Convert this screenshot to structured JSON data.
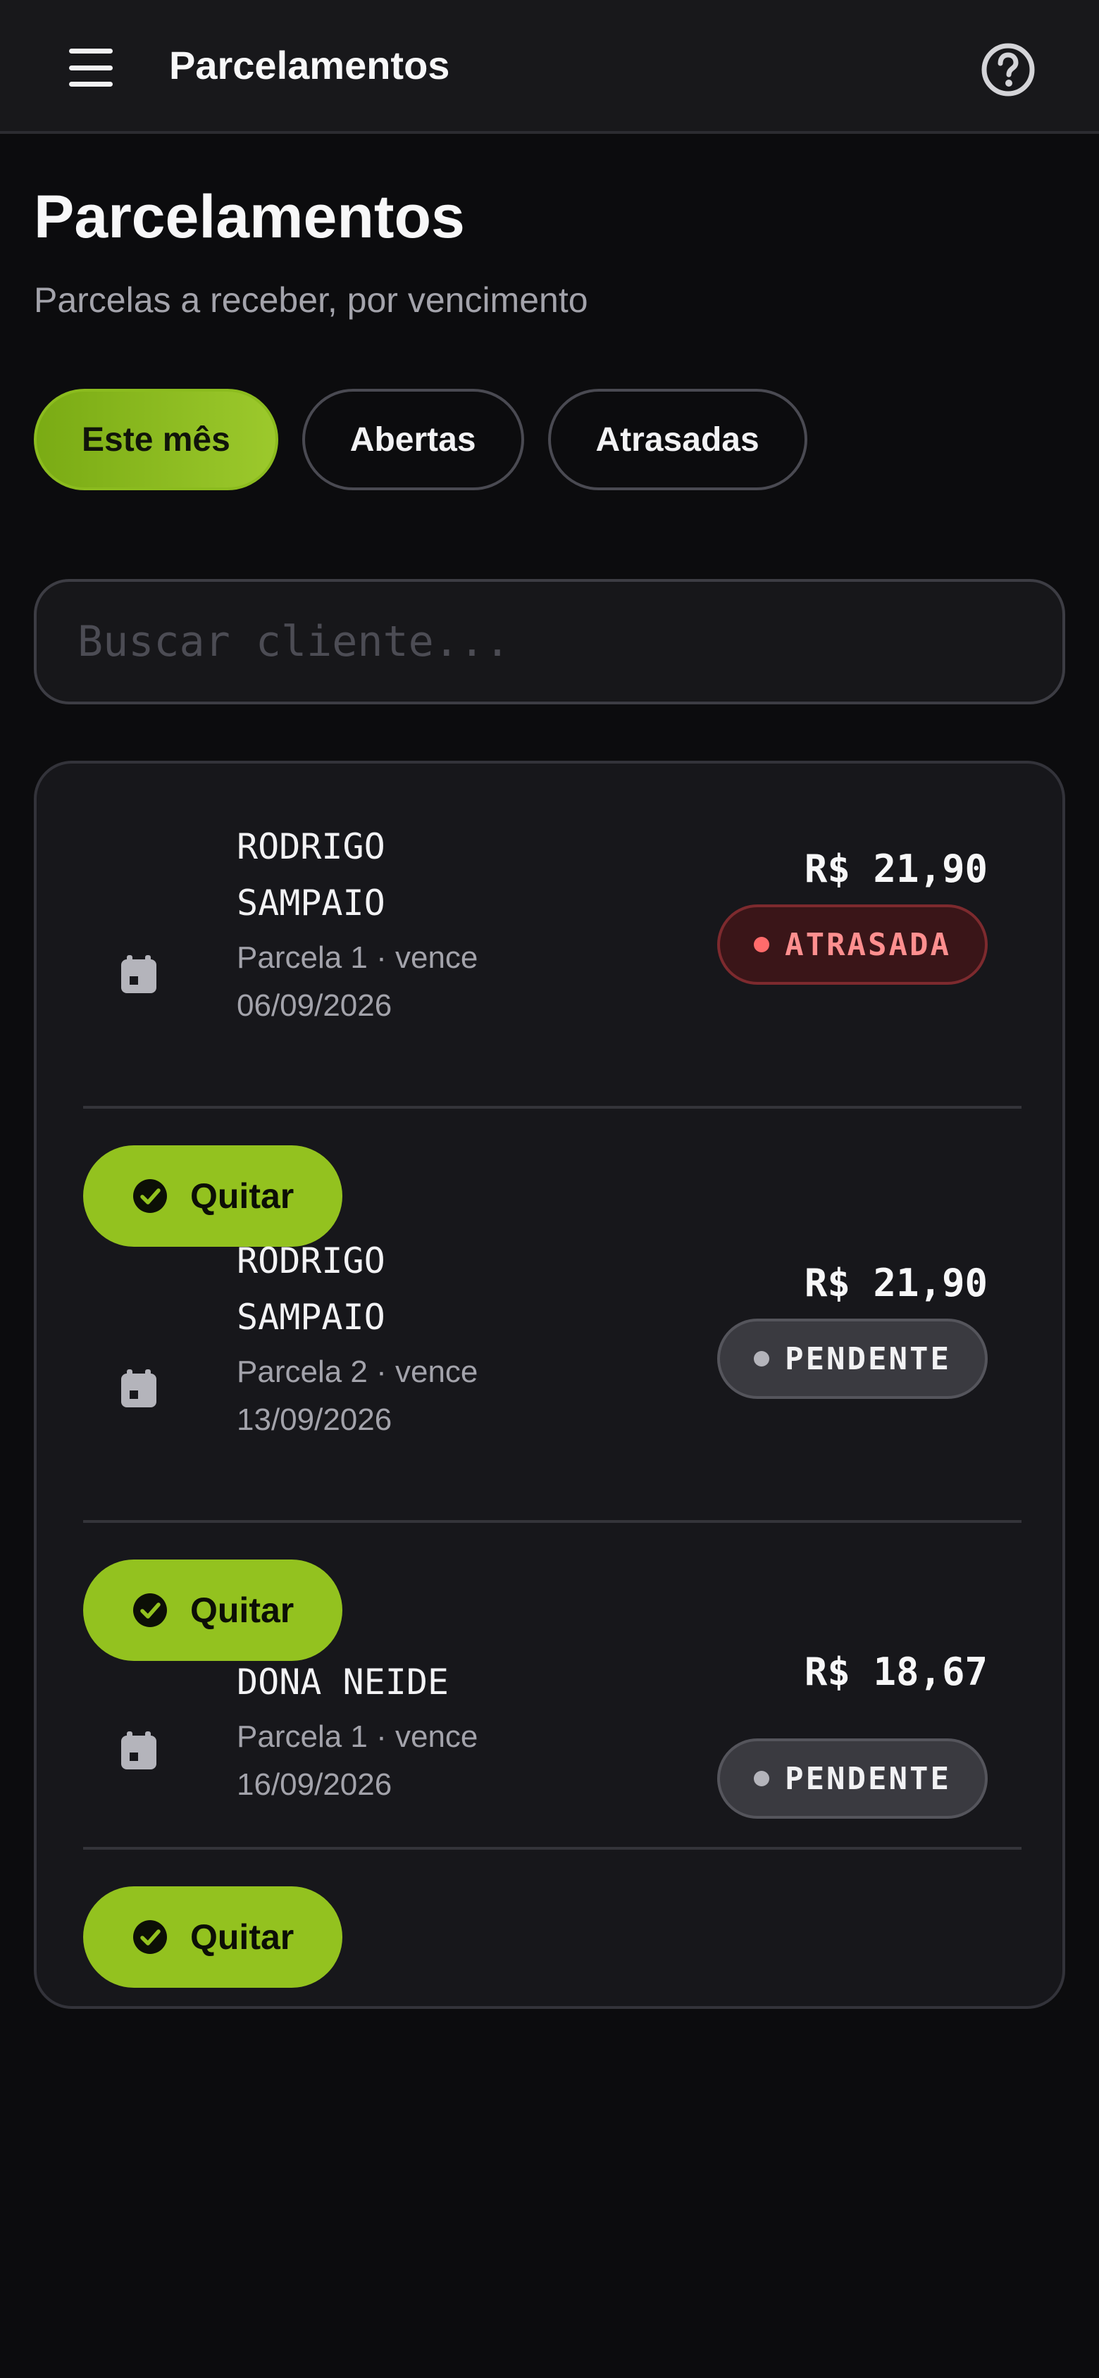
{
  "appbar": {
    "title": "Parcelamentos",
    "menu_icon": "hamburger-menu-icon",
    "help_icon": "help-circle-icon"
  },
  "header": {
    "title": "Parcelamentos",
    "subtitle": "Parcelas a receber, por vencimento"
  },
  "filters": [
    {
      "label": "Este mês",
      "active": true
    },
    {
      "label": "Abertas",
      "active": false
    },
    {
      "label": "Atrasadas",
      "active": false
    }
  ],
  "search": {
    "placeholder": "Buscar cliente...",
    "value": ""
  },
  "installments": [
    {
      "client_line1": "RODRIGO",
      "client_line2": "SAMPAIO",
      "meta_line1": "Parcela 1 · vence",
      "meta_line2": "06/09/2026",
      "amount": "R$ 21,90",
      "status": "ATRASADA",
      "status_kind": "late",
      "action": "Quitar"
    },
    {
      "client_line1": "RODRIGO",
      "client_line2": "SAMPAIO",
      "meta_line1": "Parcela 2 · vence",
      "meta_line2": "13/09/2026",
      "amount": "R$ 21,90",
      "status": "PENDENTE",
      "status_kind": "pending",
      "action": "Quitar"
    },
    {
      "client_line1": "DONA NEIDE",
      "client_line2": "",
      "meta_line1": "Parcela 1 · vence",
      "meta_line2": "16/09/2026",
      "amount": "R$ 18,67",
      "status": "PENDENTE",
      "status_kind": "pending",
      "action": "Quitar"
    }
  ],
  "colors": {
    "accent": "#93c21f",
    "background": "#0c0c0e",
    "surface": "#17171b",
    "late": "#ff6b6b",
    "pending": "#b4b4bb"
  }
}
